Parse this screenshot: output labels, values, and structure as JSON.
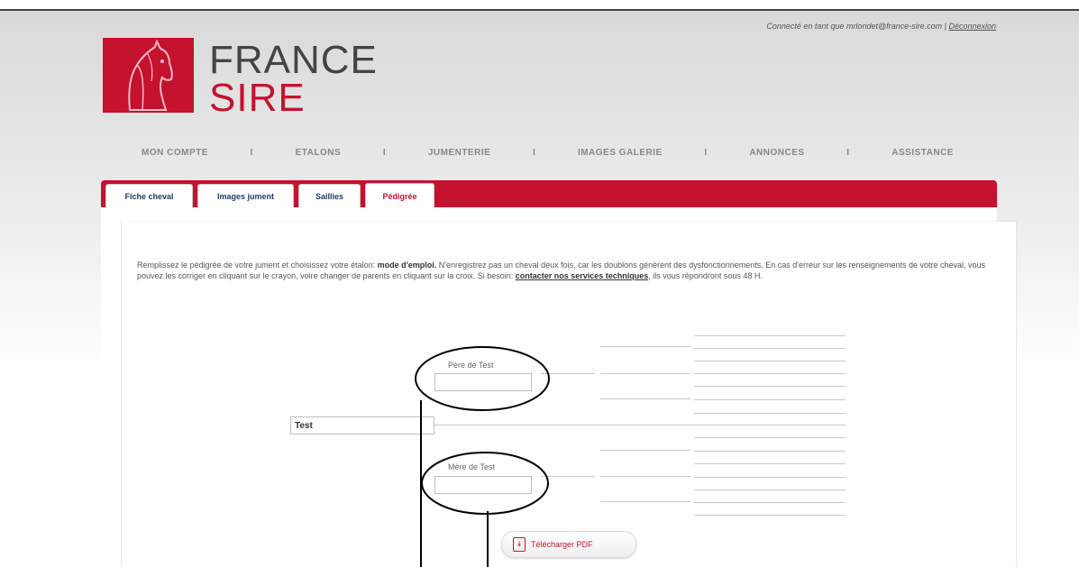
{
  "header": {
    "account_text": "Connecté en tant que mrlondet@france-sire.com | ",
    "logout_label": "Déconnexion",
    "logo_line1": "FRANCE",
    "logo_line2": "SIRE"
  },
  "nav": {
    "items": [
      "MON COMPTE",
      "ETALONS",
      "JUMENTERIE",
      "IMAGES GALERIE",
      "ANNONCES",
      "ASSISTANCE"
    ],
    "separator": "I"
  },
  "tabs": [
    {
      "label": "Fiche cheval"
    },
    {
      "label": "Images jument"
    },
    {
      "label": "Saillies"
    },
    {
      "label": "Pédigrée"
    }
  ],
  "instructions": {
    "part1": "Remplissez le pédigrée de votre jument et choisissez votre étalon: ",
    "bold1": "mode d'emploi.",
    "part2": " N'enregistrez pas un cheval deux fois, car les doublons génèrent des dysfonctionnements. En cas d'erreur sur les renseignements de votre cheval, vous pouvez les corriger en cliquant sur le crayon, voire changer de parents en cliquant sur la croix. Si besoin: ",
    "link": "contacter nos services techniques",
    "part3": ", ils vous répondront sous 48 H."
  },
  "pedigree": {
    "horse_value": "Test",
    "sire_label": "Père de Test",
    "sire_value": "",
    "dam_label": "Mère de Test",
    "dam_value": ""
  },
  "pdf_button": {
    "label": "Télécharger PDF",
    "icon": "pdf-icon"
  },
  "colors": {
    "brand_red": "#c4122f",
    "tab_text": "#1f3d6b"
  }
}
